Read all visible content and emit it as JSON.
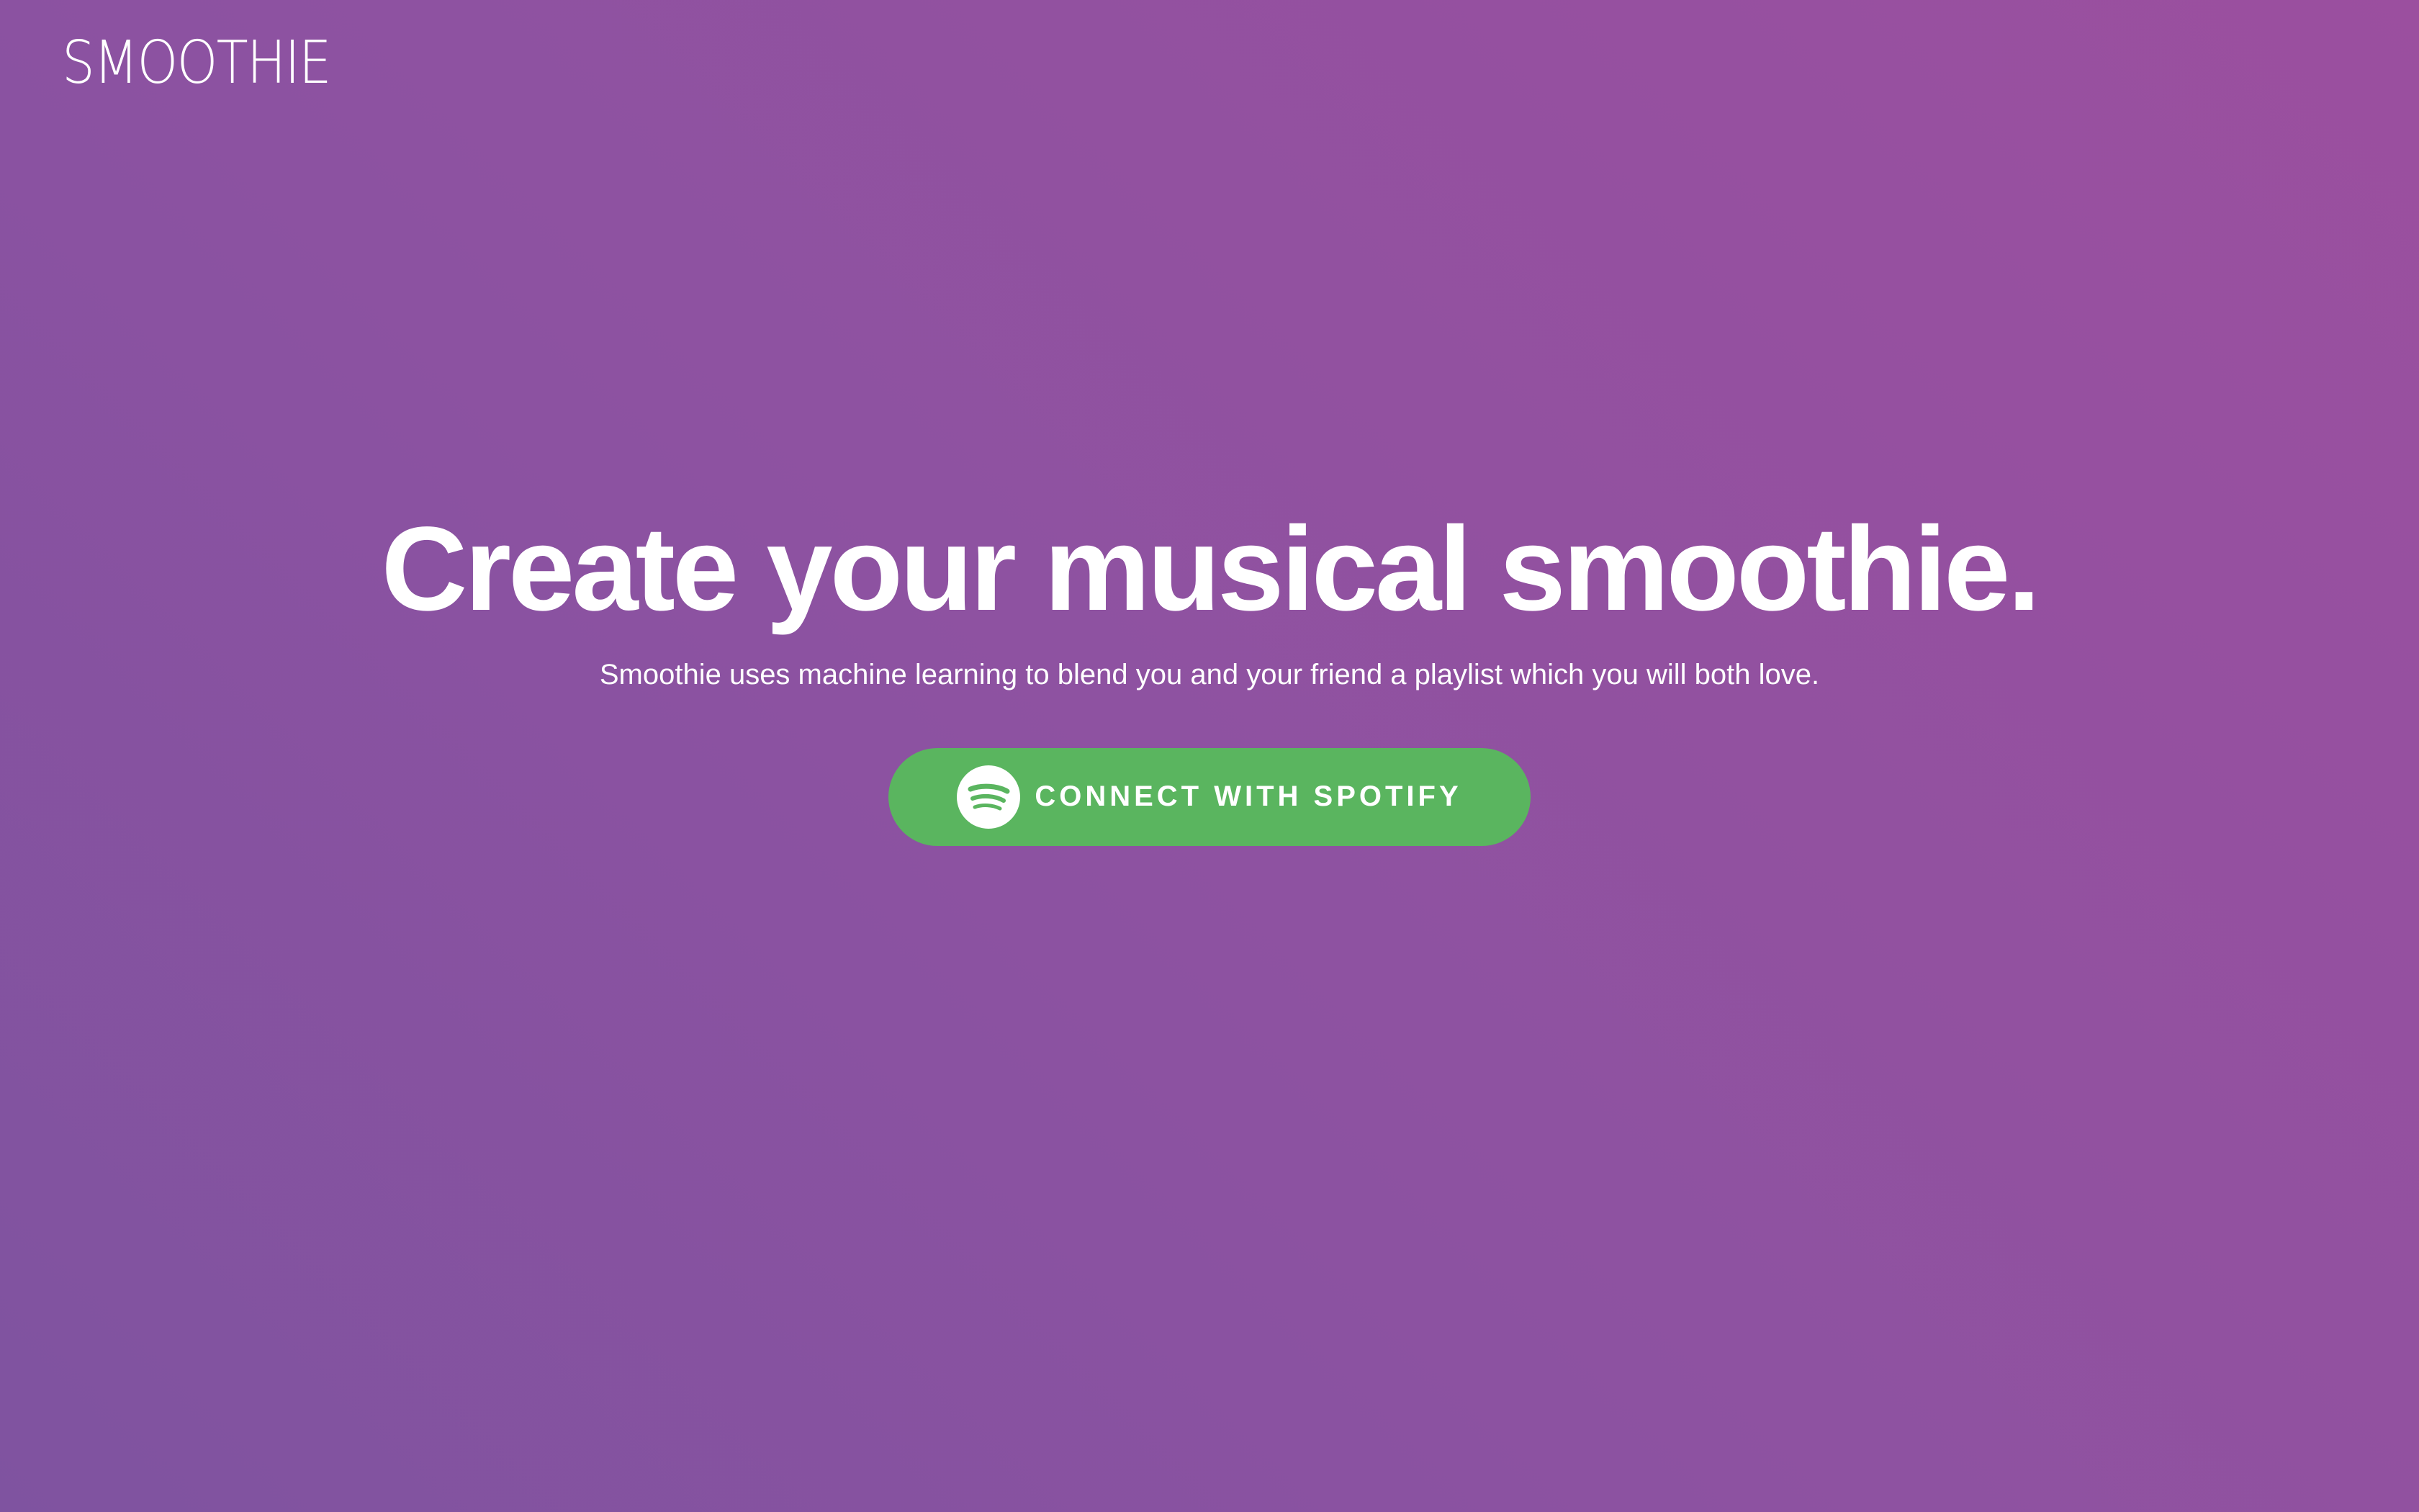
{
  "brand": {
    "logo_text": "SMOOTHIE"
  },
  "hero": {
    "headline": "Create your musical smoothie.",
    "subline": "Smoothie uses machine learning to blend you and your friend a playlist which you will both love."
  },
  "cta": {
    "label": "CONNECT WITH SPOTIFY",
    "icon": "spotify-icon"
  },
  "colors": {
    "background_start": "#7f53a0",
    "background_end": "#9b4f9f",
    "button": "#5ab55f",
    "text": "#ffffff"
  }
}
